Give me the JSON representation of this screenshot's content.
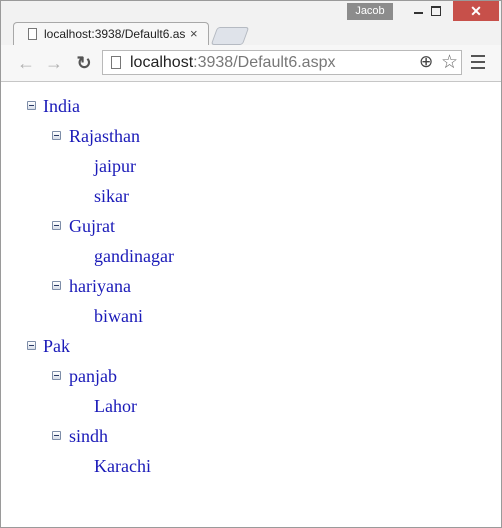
{
  "titlebar": {
    "user": "Jacob",
    "close_glyph": "✕"
  },
  "tab": {
    "title": "localhost:3938/Default6.as",
    "close_glyph": "×"
  },
  "toolbar": {
    "back_glyph": "←",
    "forward_glyph": "→",
    "reload_glyph": "↻",
    "url_host": "localhost",
    "url_path": ":3938/Default6.aspx",
    "zoom_glyph": "⊕",
    "star_glyph": "☆"
  },
  "tree": [
    {
      "label": "India",
      "expanded": true,
      "level": 0
    },
    {
      "label": "Rajasthan",
      "expanded": true,
      "level": 1
    },
    {
      "label": "jaipur",
      "level": 2
    },
    {
      "label": "sikar",
      "level": 2
    },
    {
      "label": "Gujrat",
      "expanded": true,
      "level": 1
    },
    {
      "label": "gandinagar",
      "level": 2
    },
    {
      "label": "hariyana",
      "expanded": true,
      "level": 1
    },
    {
      "label": "biwani",
      "level": 2
    },
    {
      "label": "Pak",
      "expanded": true,
      "level": 0
    },
    {
      "label": "panjab",
      "expanded": true,
      "level": 1
    },
    {
      "label": "Lahor",
      "level": 2
    },
    {
      "label": "sindh",
      "expanded": true,
      "level": 1
    },
    {
      "label": "Karachi",
      "level": 2
    }
  ]
}
